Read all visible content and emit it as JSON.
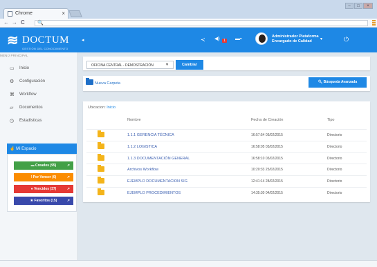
{
  "browser": {
    "tab_title": "Chrome",
    "tab_close": "×",
    "nav_back": "←",
    "nav_forward": "→",
    "nav_reload": "C",
    "omnibox_icon": "🔍",
    "win_min": "–",
    "win_max": "□",
    "win_close": "×"
  },
  "header": {
    "logo_name": "DOCTUM",
    "logo_sub": "GESTIÓN DEL CONOCIMIENTO",
    "menu_toggle": "◂",
    "notif_count": "1",
    "user_name": "Administrador Plataforma",
    "user_role": "Encargado de Calidad",
    "user_caret": "▾",
    "power_icon": "⏻"
  },
  "sidebar": {
    "title": "MENÚ PRINCIPAL",
    "items": [
      {
        "label": "Inicio",
        "icon": "▭"
      },
      {
        "label": "Configuración",
        "icon": "⚙"
      },
      {
        "label": "Workflow",
        "icon": "⌘"
      },
      {
        "label": "Documentos",
        "icon": "▱"
      },
      {
        "label": "Estadísticas",
        "icon": "◷"
      }
    ],
    "space_title": "Mi Espacio",
    "space_buttons": [
      {
        "label": "Creados (95)",
        "color": "#43a047"
      },
      {
        "label": "Por Vencer (0)",
        "color": "#fb8c00"
      },
      {
        "label": "Vencidos (37)",
        "color": "#e53935"
      },
      {
        "label": "Favoritos (15)",
        "color": "#3949ab"
      }
    ]
  },
  "office": {
    "selected": "OFICINA CENTRAL - DEMOSTRACIÓN",
    "change_button": "Cambiar"
  },
  "actions": {
    "new_folder": "Nueva Carpeta",
    "advanced_search": "Búsqueda Avanzada"
  },
  "listing": {
    "location_label": "Ubicacion:",
    "location_link": "Inicio",
    "columns": [
      "Nombre",
      "Fecha de Creación",
      "Tipo"
    ],
    "rows": [
      {
        "name": "1.1.1 GERENCIA TÉCNICA",
        "date": "16:57:54 03/02/2015",
        "type": "Directorio"
      },
      {
        "name": "1.1.2 LOGISTICA",
        "date": "16:58:05 03/02/2015",
        "type": "Directorio"
      },
      {
        "name": "1.1.3 DOCUMENTACIÓN GENERAL",
        "date": "16:58:10 03/02/2015",
        "type": "Directorio"
      },
      {
        "name": "Archivos Workflow",
        "date": "10:20:33 25/02/2015",
        "type": "Directorio"
      },
      {
        "name": "EJEMPLO DOCUMENTACION SIG",
        "date": "12:41:14 28/02/2015",
        "type": "Directorio"
      },
      {
        "name": "EJEMPLO PROCEDIMIENTOS",
        "date": "14:35:30 04/02/2015",
        "type": "Directorio"
      }
    ]
  }
}
